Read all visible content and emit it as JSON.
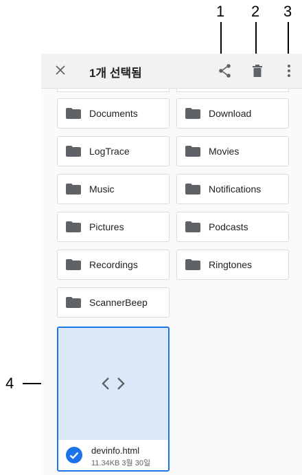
{
  "callouts": {
    "share": "1",
    "delete": "2",
    "more": "3",
    "file_thumbnail": "4"
  },
  "toolbar": {
    "title": "1개 선택됨",
    "icons": {
      "close": "close-icon",
      "share": "share-icon",
      "delete": "delete-icon",
      "more": "more-vert-icon"
    }
  },
  "folders": [
    {
      "name": "Documents"
    },
    {
      "name": "Download"
    },
    {
      "name": "LogTrace"
    },
    {
      "name": "Movies"
    },
    {
      "name": "Music"
    },
    {
      "name": "Notifications"
    },
    {
      "name": "Pictures"
    },
    {
      "name": "Podcasts"
    },
    {
      "name": "Recordings"
    },
    {
      "name": "Ringtones"
    },
    {
      "name": "ScannerBeep"
    }
  ],
  "selected_file": {
    "name": "devinfo.html",
    "meta": "11.34KB 3월 30일",
    "icon": "code-icon",
    "selected": true
  },
  "colors": {
    "accent": "#1a73e8",
    "thumb_bg": "#dbe9f9",
    "folder": "#5f6368",
    "toolbar_bg": "#f2f2f2"
  }
}
